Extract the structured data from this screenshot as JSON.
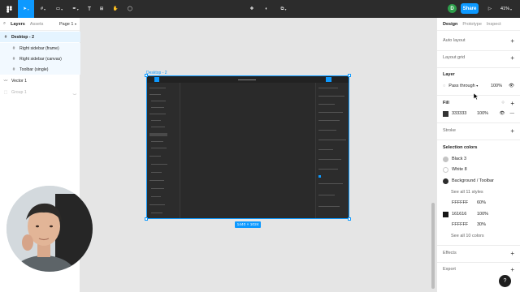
{
  "toolbar": {
    "share_label": "Share",
    "zoom_label": "41%",
    "user_initial": "D"
  },
  "left_panel": {
    "tabs": [
      "Layers",
      "Assets"
    ],
    "page_label": "Page 1",
    "layers": [
      {
        "name": "Desktop - 2",
        "state": "selected"
      },
      {
        "name": "Right sidebar (frame)",
        "state": "child"
      },
      {
        "name": "Right sidebar (canvas)",
        "state": "child"
      },
      {
        "name": "Toolbar (single)",
        "state": "child"
      },
      {
        "name": "Vector 1",
        "state": "normal"
      },
      {
        "name": "Group 1",
        "state": "hidden"
      }
    ]
  },
  "canvas": {
    "frame_label": "Desktop - 2",
    "size_badge": "1440 × 1024"
  },
  "right_panel": {
    "tabs": [
      "Design",
      "Prototype",
      "Inspect"
    ],
    "auto_layout": "Auto layout",
    "layout_grid": "Layout grid",
    "layer_title": "Layer",
    "blend_mode": "Pass through",
    "layer_opacity": "100%",
    "fill_title": "Fill",
    "fill_hex": "333333",
    "fill_opacity": "100%",
    "stroke_title": "Stroke",
    "selection_colors_title": "Selection colors",
    "styles": [
      {
        "name": "Black 3",
        "color": "#c4c4c4"
      },
      {
        "name": "White 8",
        "color": "#ffffff"
      },
      {
        "name": "Background / Toolbar",
        "color": "#2c2c2c"
      }
    ],
    "see_all_styles": "See all 11 styles",
    "colors": [
      {
        "hex": "FFFFFF",
        "opacity": "60%",
        "color": "#ffffff"
      },
      {
        "hex": "161616",
        "opacity": "100%",
        "color": "#161616"
      },
      {
        "hex": "FFFFFF",
        "opacity": "30%",
        "color": "#ffffff"
      }
    ],
    "see_all_colors": "See all 10 colors",
    "effects_title": "Effects",
    "export_title": "Export"
  },
  "colors": {
    "accent": "#0d99ff",
    "toolbar_bg": "#2c2c2c"
  }
}
